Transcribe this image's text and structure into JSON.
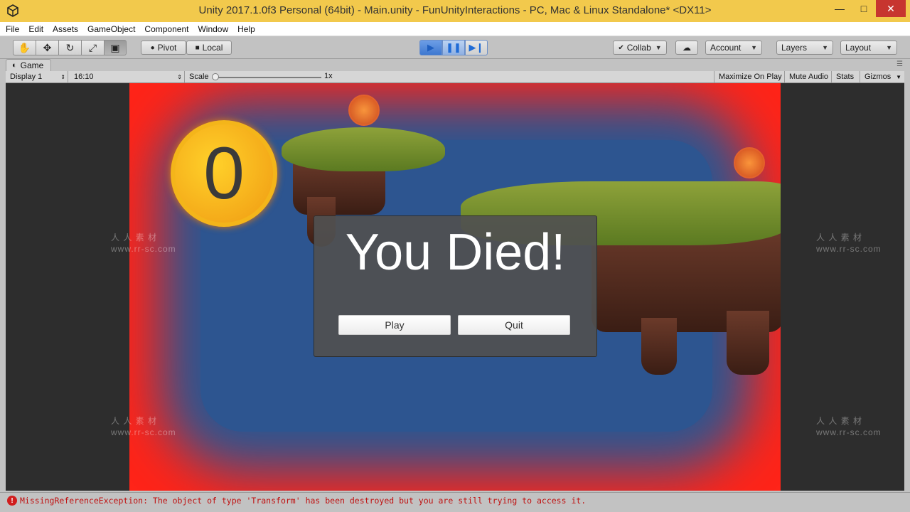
{
  "window": {
    "title": "Unity 2017.1.0f3 Personal (64bit) - Main.unity - FunUnityInteractions - PC, Mac & Linux Standalone* <DX11>",
    "minimize": "—",
    "maximize": "□",
    "close": "✕"
  },
  "menu": [
    "File",
    "Edit",
    "Assets",
    "GameObject",
    "Component",
    "Window",
    "Help"
  ],
  "toolbar": {
    "pivot": "Pivot",
    "local": "Local",
    "collab": "Collab",
    "account": "Account",
    "layers": "Layers",
    "layout": "Layout"
  },
  "tab": {
    "label": "Game"
  },
  "game_bar": {
    "display": "Display 1",
    "aspect": "16:10",
    "scale_label": "Scale",
    "scale_value": "1x",
    "maximize_on_play": "Maximize On Play",
    "mute_audio": "Mute Audio",
    "stats": "Stats",
    "gizmos": "Gizmos"
  },
  "game": {
    "score": "0",
    "dialog_title": "You Died!",
    "play_button": "Play",
    "quit_button": "Quit"
  },
  "watermark": {
    "cn": "人 人 素 材",
    "url": "www.rr-sc.com"
  },
  "status": {
    "error": "MissingReferenceException: The object of type 'Transform' has been destroyed but you are still trying to access it."
  }
}
